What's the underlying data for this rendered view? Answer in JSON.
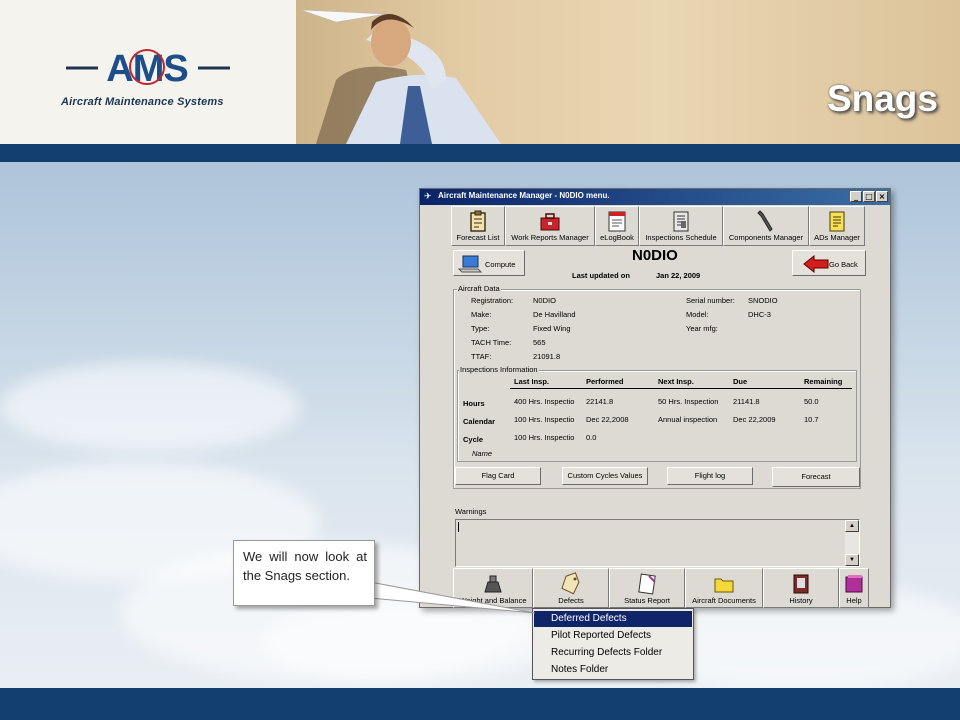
{
  "slide": {
    "title": "Snags",
    "logo_mark": "AMS",
    "logo_caption": "Aircraft Maintenance Systems"
  },
  "window": {
    "title": "Aircraft Maintenance Manager - N0DIO menu.",
    "top_toolbar": [
      {
        "label": "Forecast List",
        "icon": "clipboard-icon"
      },
      {
        "label": "Work Reports Manager",
        "icon": "toolbox-icon"
      },
      {
        "label": "eLogBook",
        "icon": "logbook-icon"
      },
      {
        "label": "Inspections Schedule",
        "icon": "schedule-icon"
      },
      {
        "label": "Components Manager",
        "icon": "wrench-icon"
      },
      {
        "label": "ADs Manager",
        "icon": "notepad-icon"
      }
    ],
    "compute_label": "Compute",
    "go_back_label": "Go Back",
    "aircraft_name": "N0DIO",
    "last_updated_label": "Last updated on",
    "last_updated_value": "Jan 22, 2009",
    "aircraft_data": {
      "legend": "Aircraft Data",
      "registration_label": "Registration:",
      "registration": "N0DIO",
      "make_label": "Make:",
      "make": "De Havilland",
      "type_label": "Type:",
      "type": "Fixed Wing",
      "tach_label": "TACH Time:",
      "tach": "565",
      "ttaf_label": "TTAF:",
      "ttaf": "21091.8",
      "serial_label": "Serial number:",
      "serial": "SNODIO",
      "model_label": "Model:",
      "model": "DHC-3",
      "year_label": "Year mfg:",
      "year": ""
    },
    "inspections": {
      "legend": "Inspections Information",
      "headers": [
        "Last Insp.",
        "Performed",
        "Next Insp.",
        "Due",
        "Remaining"
      ],
      "rows": [
        {
          "label": "Hours",
          "last": "400 Hrs. Inspectio",
          "performed": "22141.8",
          "next": "50 Hrs. Inspection",
          "due": "21141.8",
          "remaining": "50.0"
        },
        {
          "label": "Calendar",
          "last": "100 Hrs. Inspectio",
          "performed": "Dec 22,2008",
          "next": "Annual inspection",
          "due": "Dec 22,2009",
          "remaining": "10.7"
        },
        {
          "label": "Cycle",
          "last": "100 Hrs. Inspectio",
          "performed": "0.0",
          "next": "",
          "due": "",
          "remaining": ""
        }
      ],
      "name_label": "Name"
    },
    "action_buttons": [
      "Flag Card",
      "Custom Cycles Values",
      "Flight log",
      "Forecast"
    ],
    "warnings_label": "Warnings",
    "bottom_toolbar": [
      {
        "label": "Weight and Balance",
        "icon": "scale-icon"
      },
      {
        "label": "Defects",
        "icon": "tag-icon"
      },
      {
        "label": "Status Report",
        "icon": "report-icon"
      },
      {
        "label": "Aircraft Documents",
        "icon": "folder-icon"
      },
      {
        "label": "History",
        "icon": "history-book-icon"
      },
      {
        "label": "Help",
        "icon": "help-book-icon"
      }
    ]
  },
  "defects_menu": {
    "items": [
      "Deferred Defects",
      "Pilot Reported Defects",
      "Recurring Defects Folder",
      "Notes Folder"
    ],
    "selected": "Deferred Defects"
  },
  "callout": {
    "text": "We will now look at the Snags section."
  },
  "colors": {
    "band": "#123f6e",
    "titlebar": "#0a246a",
    "menu_highlight": "#10246a",
    "logo_red": "#c0272d",
    "logo_blue": "#1d4e89"
  }
}
